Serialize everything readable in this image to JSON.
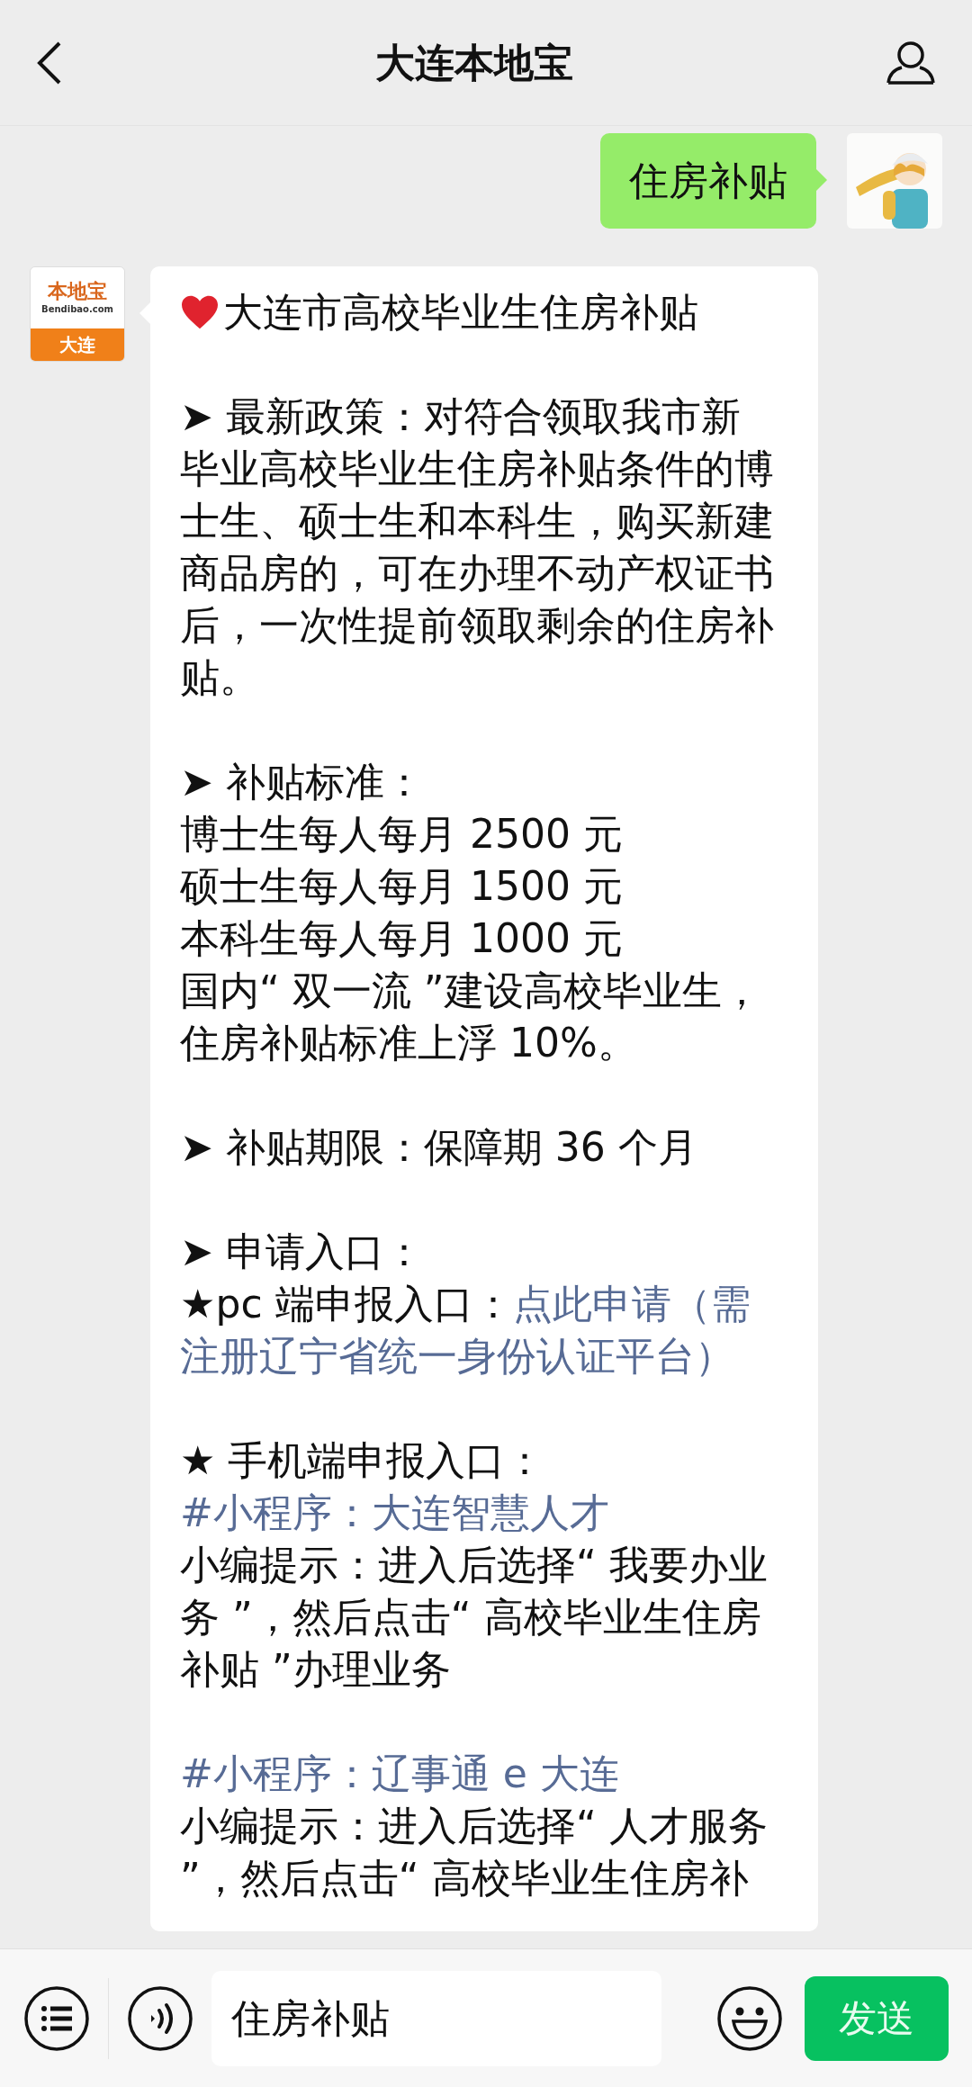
{
  "header": {
    "title": "大连本地宝"
  },
  "messages": [
    {
      "kind": "outgoing",
      "text": "住房补贴"
    },
    {
      "kind": "incoming",
      "logo": {
        "name": "本地宝",
        "site": "Bendibao.com",
        "city": "大连"
      },
      "sections": [
        {
          "paragraphs": [
            {
              "kind": "heading",
              "parts": [
                {
                  "kind": "plain",
                  "text": "大连市高校毕业生住房补贴"
                }
              ]
            }
          ]
        },
        {
          "paragraphs": [
            {
              "kind": "text",
              "parts": [
                {
                  "kind": "plain",
                  "text": "➤ 最新政策：对符合领取我市新毕业高校毕业生住房补贴条件的博士生、硕士生和本科生，购买新建商品房的，可在办理不动产权证书后，一次性提前领取剩余的住房补贴。"
                }
              ]
            }
          ]
        },
        {
          "paragraphs": [
            {
              "kind": "text",
              "parts": [
                {
                  "kind": "plain",
                  "text": "➤ 补贴标准："
                }
              ]
            },
            {
              "kind": "text",
              "parts": [
                {
                  "kind": "plain",
                  "text": "博士生每人每月 2500 元"
                }
              ]
            },
            {
              "kind": "text",
              "parts": [
                {
                  "kind": "plain",
                  "text": "硕士生每人每月 1500 元"
                }
              ]
            },
            {
              "kind": "text",
              "parts": [
                {
                  "kind": "plain",
                  "text": "本科生每人每月 1000 元"
                }
              ]
            },
            {
              "kind": "text",
              "parts": [
                {
                  "kind": "plain",
                  "text": "国内“ 双一流 ”建设高校毕业生，住房补贴标准上浮 10%。"
                }
              ]
            }
          ]
        },
        {
          "paragraphs": [
            {
              "kind": "text",
              "parts": [
                {
                  "kind": "plain",
                  "text": "➤ 补贴期限：保障期 36 个月"
                }
              ]
            }
          ]
        },
        {
          "paragraphs": [
            {
              "kind": "text",
              "parts": [
                {
                  "kind": "plain",
                  "text": "➤ 申请入口："
                }
              ]
            },
            {
              "kind": "text",
              "parts": [
                {
                  "kind": "plain",
                  "text": "★pc 端申报入口："
                },
                {
                  "kind": "link",
                  "text": "点此申请（需"
                },
                {
                  "kind": "link",
                  "text": "注册辽宁省统一身份认证平台）"
                }
              ]
            }
          ]
        },
        {
          "paragraphs": [
            {
              "kind": "text",
              "parts": [
                {
                  "kind": "plain",
                  "text": "★ 手机端申报入口："
                }
              ]
            },
            {
              "kind": "text",
              "parts": [
                {
                  "kind": "link",
                  "text": "#小程序：大连智慧人才"
                }
              ]
            },
            {
              "kind": "text",
              "parts": [
                {
                  "kind": "plain",
                  "text": "小编提示：进入后选择“ 我要办业务 ”，然后点击“ 高校毕业生住房补贴 ”办理业务"
                }
              ]
            }
          ]
        },
        {
          "paragraphs": [
            {
              "kind": "text",
              "parts": [
                {
                  "kind": "link",
                  "text": "#小程序：辽事通 e 大连"
                }
              ]
            },
            {
              "kind": "text",
              "parts": [
                {
                  "kind": "plain",
                  "text": "小编提示：进入后选择“ 人才服务 ”，然后点击“ 高校毕业生住房补"
                }
              ]
            }
          ]
        }
      ]
    }
  ],
  "input_bar": {
    "value": "住房补贴",
    "send_label": "发送"
  }
}
